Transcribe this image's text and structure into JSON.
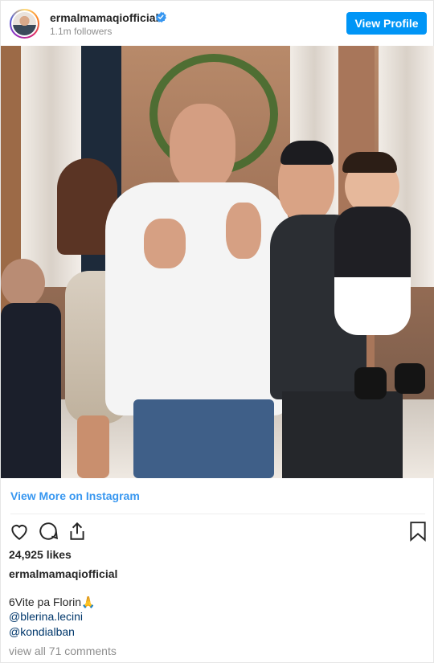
{
  "header": {
    "username": "ermalmamaqiofficial",
    "followers": "1.1m followers",
    "view_profile_label": "View Profile"
  },
  "photo": {
    "description_icon": "photo"
  },
  "footer": {
    "view_more_label": "View More on Instagram",
    "likes": "24,925 likes",
    "owner": "ermalmamaqiofficial",
    "caption": "6Vite pa Florin🙏",
    "mentions": [
      "@blerina.lecini",
      "@kondialban"
    ],
    "comments_link": "view all 71 comments"
  },
  "colors": {
    "accent": "#0095f6",
    "link": "#3897f0",
    "mention": "#00376b",
    "muted": "#8e8e8e"
  },
  "icons": [
    "verified-badge-icon",
    "heart-icon",
    "comment-icon",
    "share-icon",
    "bookmark-icon"
  ]
}
